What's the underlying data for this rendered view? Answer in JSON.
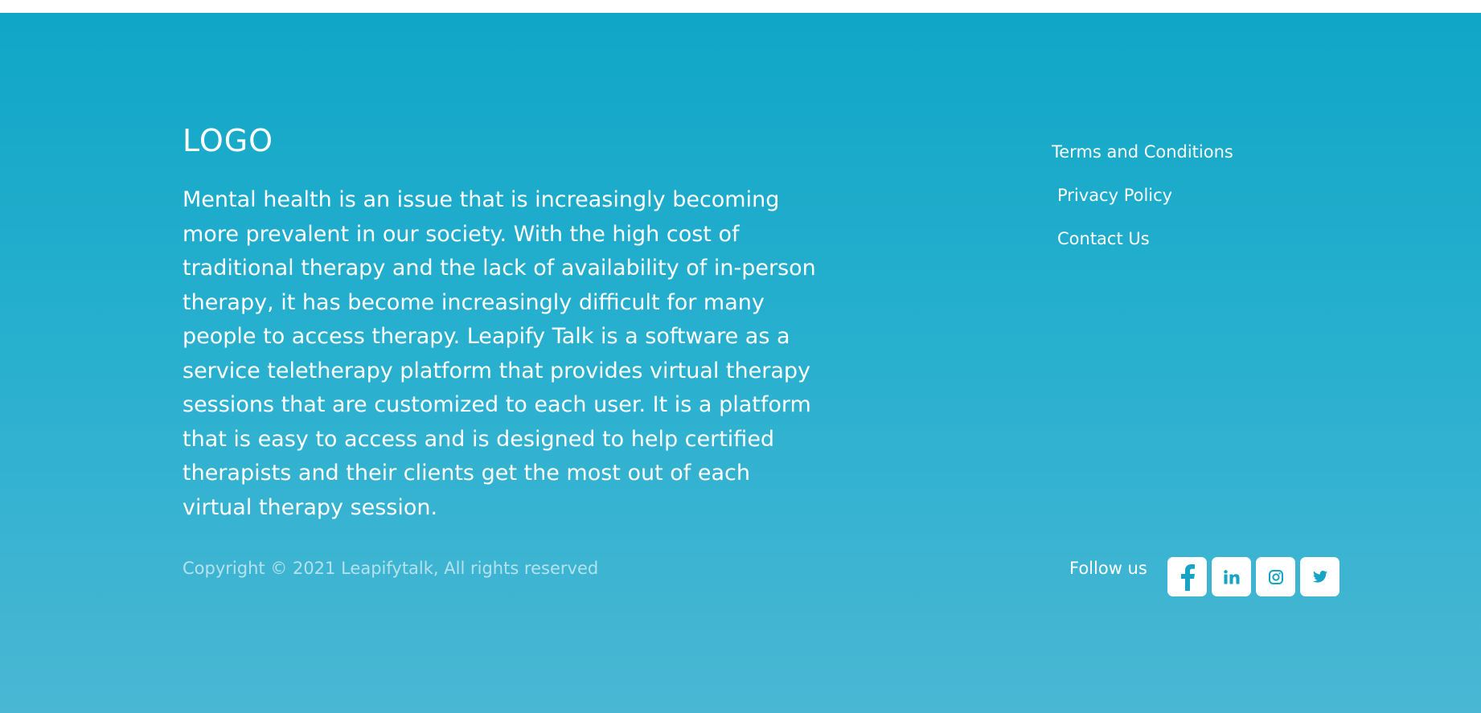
{
  "footer": {
    "logo": "LOGO",
    "about": "Mental health is an issue that is increasingly becoming more prevalent in our society. With the high cost of traditional therapy and the lack of availability of in-person therapy, it has become increasingly difficult for many people to access therapy. Leapify Talk is a software as a service teletherapy platform that provides virtual therapy sessions that are customized to each user. It is a platform that is easy to access and is designed to help certified therapists and their clients get the most out of each virtual therapy session.",
    "links": [
      {
        "label": "Terms and Conditions"
      },
      {
        "label": "Privacy Policy"
      },
      {
        "label": "Contact Us"
      }
    ],
    "copyright": "Copyright © 2021 Leapifytalk, All rights reserved",
    "follow_label": "Follow us",
    "socials": [
      {
        "icon": "facebook-icon"
      },
      {
        "icon": "linkedin-icon"
      },
      {
        "icon": "instagram-icon"
      },
      {
        "icon": "twitter-icon"
      }
    ],
    "colors": {
      "gradient_top": "#10a6c7",
      "gradient_bottom": "#4ab7d4",
      "icon_color": "#16a4c6",
      "text": "#ffffff"
    }
  }
}
